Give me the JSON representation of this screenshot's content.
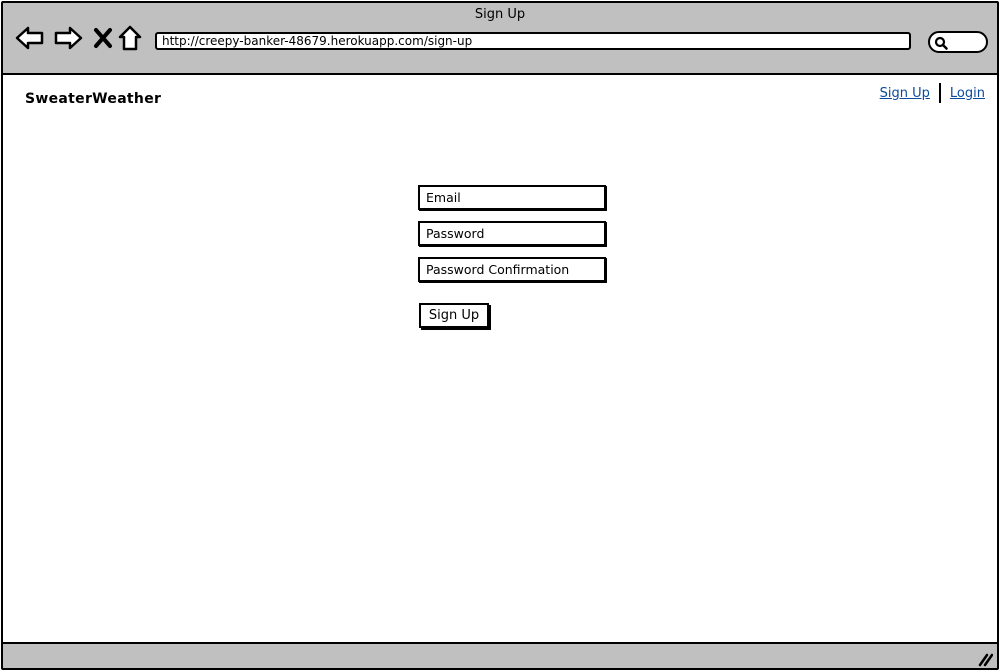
{
  "window": {
    "title": "Sign Up",
    "url": "http://creepy-banker-48679.herokuapp.com/sign-up"
  },
  "toolbar": {
    "icons": [
      "back-icon",
      "forward-icon",
      "stop-icon",
      "home-icon",
      "search-icon"
    ]
  },
  "header": {
    "brand": "SweaterWeather",
    "links": {
      "signup": "Sign Up",
      "login": "Login"
    }
  },
  "form": {
    "email_placeholder": "Email",
    "password_placeholder": "Password",
    "password_confirmation_placeholder": "Password Confirmation",
    "submit_label": "Sign Up"
  },
  "colors": {
    "chrome": "#c0c0c0",
    "link": "#0b4a9c"
  }
}
